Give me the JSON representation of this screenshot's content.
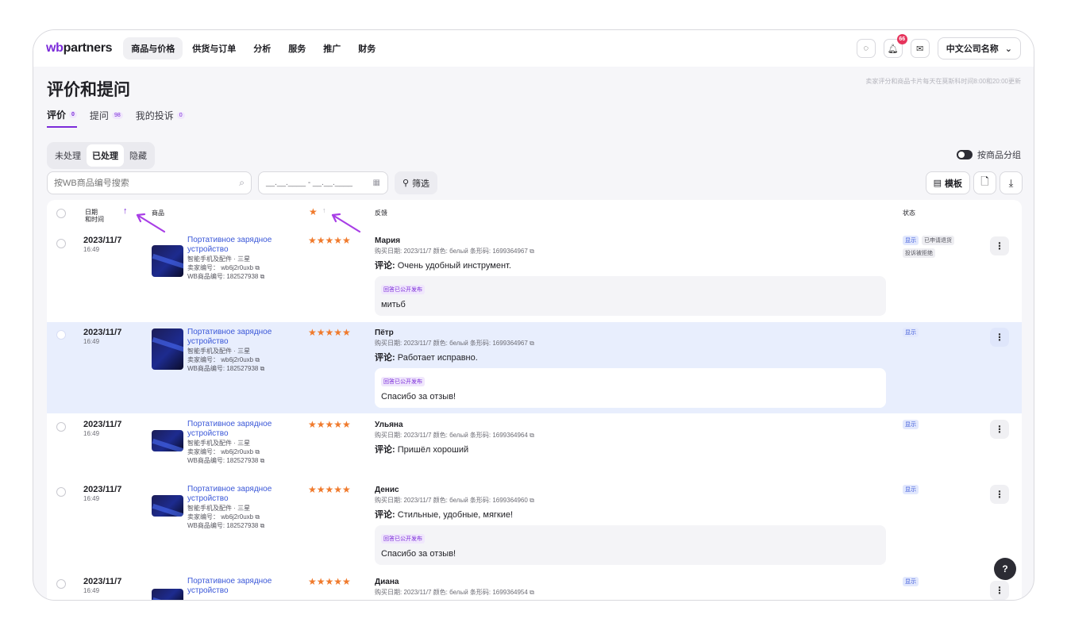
{
  "brand": {
    "logo_wb": "wb",
    "logo_rest": "partners"
  },
  "nav": [
    "商品与价格",
    "供货与订单",
    "分析",
    "服务",
    "推广",
    "财务"
  ],
  "header": {
    "notifications_count": "66",
    "company": "中文公司名称"
  },
  "page": {
    "title": "评价和提问",
    "notice": "卖家评分和商品卡片每天在莫斯科时间8:00和20:00更新"
  },
  "tabs": [
    {
      "label": "评价",
      "count": "0"
    },
    {
      "label": "提问",
      "count": "98"
    },
    {
      "label": "我的投诉",
      "count": "0"
    }
  ],
  "segments": [
    "未处理",
    "已处理",
    "隐藏"
  ],
  "group_toggle_label": "按商品分组",
  "search": {
    "placeholder": "按WB商品编号搜索"
  },
  "date_range": {
    "placeholder": "__.__.____ - __.__.____"
  },
  "toolbar": {
    "filter": "筛选",
    "template": "模板"
  },
  "table": {
    "columns": {
      "date": "日期",
      "datetime": "和时间",
      "product": "商品",
      "feedback": "反馈",
      "status": "状态"
    }
  },
  "rows": [
    {
      "date": "2023/11/7",
      "time": "16:49",
      "product_name": "Портативное зарядное устройство",
      "category": "智能手机及配件 · 三星",
      "seller_code": "卖家编号： wb6j2r0uxb",
      "wb_code": "WB商品编号: 182527938",
      "stars": "★★★★★",
      "reviewer": "Мария",
      "meta": "购买日期: 2023/11/7   颜色: белый   条形码: 1699364967",
      "comment_label": "评论:",
      "comment": "Очень удобный инструмент.",
      "reply_tag": "回答已公开发布",
      "reply": "митьб",
      "status_tags": [
        "显示",
        "已申请退货",
        "投诉被拒绝"
      ]
    },
    {
      "date": "2023/11/7",
      "time": "16:49",
      "product_name": "Портативное зарядное устройство",
      "category": "智能手机及配件 · 三星",
      "seller_code": "卖家编号： wb6j2r0uxb",
      "wb_code": "WB商品编号: 182527938",
      "stars": "★★★★★",
      "reviewer": "Пётр",
      "meta": "购买日期: 2023/11/7   颜色: белый   条形码: 1699364967",
      "comment_label": "评论:",
      "comment": "Работает исправно.",
      "reply_tag": "回答已公开发布",
      "reply": "Спасибо за отзыв!",
      "status_tags": [
        "显示"
      ]
    },
    {
      "date": "2023/11/7",
      "time": "16:49",
      "product_name": "Портативное зарядное устройство",
      "category": "智能手机及配件 · 三星",
      "seller_code": "卖家编号： wb6j2r0uxb",
      "wb_code": "WB商品编号: 182527938",
      "stars": "★★★★★",
      "reviewer": "Ульяна",
      "meta": "购买日期: 2023/11/7   颜色: белый   条形码: 1699364964",
      "comment_label": "评论:",
      "comment": "Пришёл хороший",
      "status_tags": [
        "显示"
      ]
    },
    {
      "date": "2023/11/7",
      "time": "16:49",
      "product_name": "Портативное зарядное устройство",
      "category": "智能手机及配件 · 三星",
      "seller_code": "卖家编号： wb6j2r0uxb",
      "wb_code": "WB商品编号: 182527938",
      "stars": "★★★★★",
      "reviewer": "Денис",
      "meta": "购买日期: 2023/11/7   颜色: белый   条形码: 1699364960",
      "comment_label": "评论:",
      "comment": "Стильные, удобные, мягкие!",
      "reply_tag": "回答已公开发布",
      "reply": "Спасибо за отзыв!",
      "status_tags": [
        "显示"
      ]
    },
    {
      "date": "2023/11/7",
      "time": "16:49",
      "product_name": "Портативное зарядное устройство",
      "stars": "★★★★★",
      "reviewer": "Диана",
      "meta": "购买日期: 2023/11/7   颜色: белый   条形码: 1699364954",
      "status_tags": [
        "显示"
      ]
    }
  ],
  "help_label": "?",
  "colors": {
    "accent": "#7b2bd9",
    "link": "#3a57d8",
    "star": "#f07a2c",
    "selected_row": "#e8eefd"
  }
}
